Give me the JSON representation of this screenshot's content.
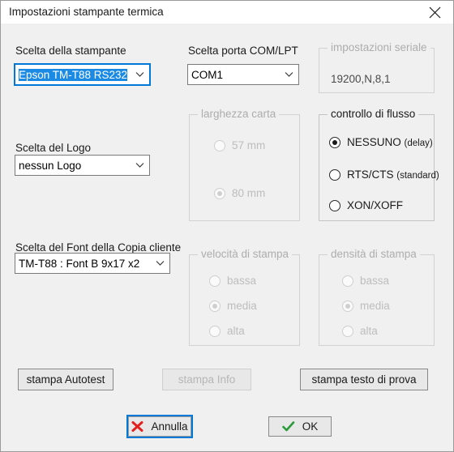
{
  "window": {
    "title": "Impostazioni stampante termica",
    "close_icon": "close-icon",
    "accent": "#0078d7",
    "background": "#f0f0f0"
  },
  "printer": {
    "label": "Scelta della stampante",
    "value": "Epson TM-T88 RS232",
    "arrow_icon": "chevron-down-icon"
  },
  "port": {
    "label": "Scelta porta COM/LPT",
    "value": "COM1",
    "arrow_icon": "chevron-down-icon"
  },
  "serial": {
    "title": "impostazioni seriale",
    "value": "19200,N,8,1"
  },
  "logo": {
    "label": "Scelta del Logo",
    "value": "nessun Logo",
    "arrow_icon": "chevron-down-icon"
  },
  "font": {
    "label": "Scelta del Font della Copia cliente",
    "value": "TM-T88 : Font B  9x17 x2",
    "arrow_icon": "chevron-down-icon"
  },
  "paper_width": {
    "title": "larghezza carta",
    "enabled": false,
    "options": [
      {
        "label": "57 mm",
        "checked": false
      },
      {
        "label": "80 mm",
        "checked": true
      }
    ]
  },
  "flow_control": {
    "title": "controllo di flusso",
    "enabled": true,
    "options": [
      {
        "label": "NESSUNO",
        "note": "(delay)",
        "checked": true
      },
      {
        "label": "RTS/CTS",
        "note": "(standard)",
        "checked": false
      },
      {
        "label": "XON/XOFF",
        "note": "",
        "checked": false
      }
    ]
  },
  "print_speed": {
    "title": "velocità di stampa",
    "enabled": false,
    "options": [
      {
        "label": "bassa",
        "checked": false
      },
      {
        "label": "media",
        "checked": true
      },
      {
        "label": "alta",
        "checked": false
      }
    ]
  },
  "print_density": {
    "title": "densità di stampa",
    "enabled": false,
    "options": [
      {
        "label": "bassa",
        "checked": false
      },
      {
        "label": "media",
        "checked": true
      },
      {
        "label": "alta",
        "checked": false
      }
    ]
  },
  "actions": {
    "autotest": {
      "label": "stampa Autotest",
      "enabled": true
    },
    "info": {
      "label": "stampa Info",
      "enabled": false
    },
    "test_text": {
      "label": "stampa testo di prova",
      "enabled": true
    }
  },
  "dialog_buttons": {
    "cancel": {
      "label": "Annulla",
      "icon": "red-x-icon",
      "icon_color": "#e32020",
      "focused": true
    },
    "ok": {
      "label": "OK",
      "icon": "green-check-icon",
      "icon_color": "#2a9a3a",
      "focused": false
    }
  }
}
